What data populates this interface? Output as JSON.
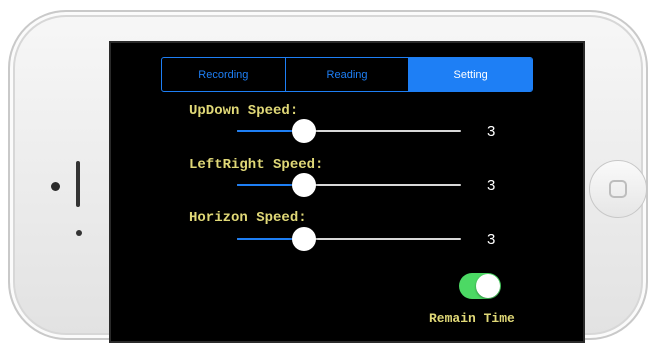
{
  "tabs": [
    {
      "label": "Recording",
      "active": false
    },
    {
      "label": "Reading",
      "active": false
    },
    {
      "label": "Setting",
      "active": true
    }
  ],
  "settings": {
    "updown": {
      "label": "UpDown Speed:",
      "value": "3",
      "level": 0.3
    },
    "leftright": {
      "label": "LeftRight Speed:",
      "value": "3",
      "level": 0.3
    },
    "horizon": {
      "label": "Horizon Speed:",
      "value": "3",
      "level": 0.3
    }
  },
  "remain_time": {
    "label": "Remain Time",
    "on": true
  },
  "colors": {
    "accent": "#1e7ff5",
    "label_text": "#e0d877",
    "toggle_on": "#4cd964",
    "screen_bg": "#000000"
  }
}
